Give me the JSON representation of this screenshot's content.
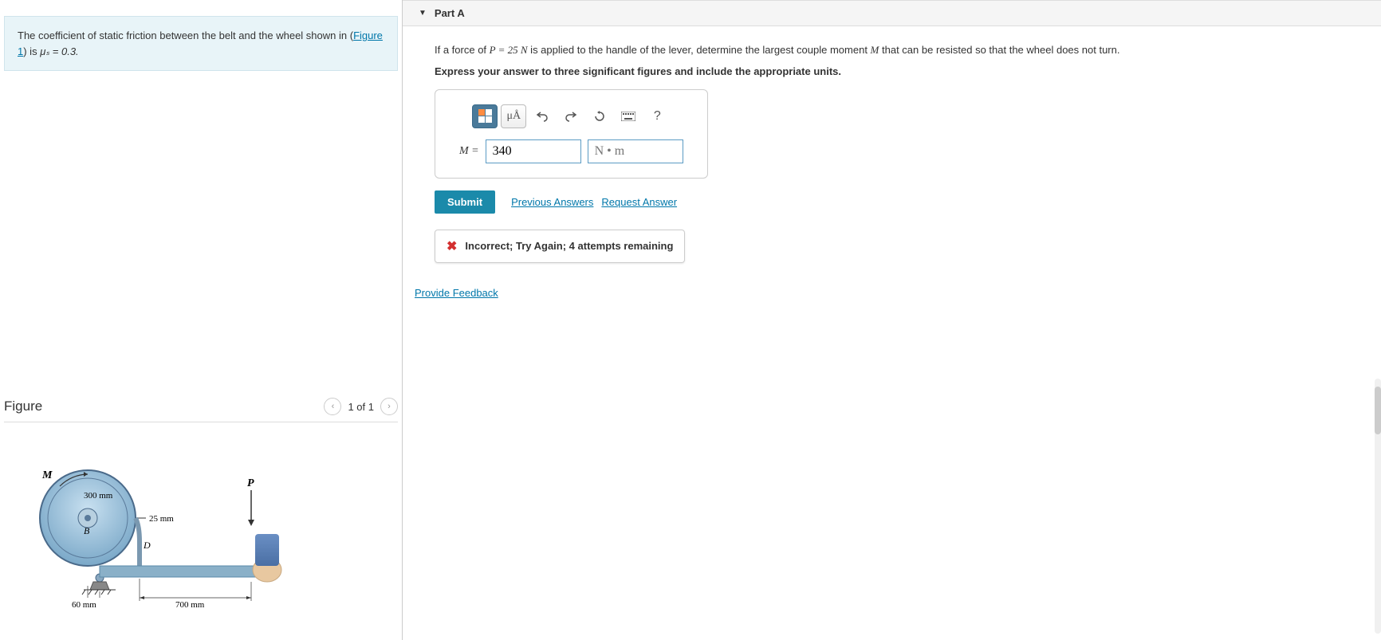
{
  "problem": {
    "text_before_link": "The coefficient of static friction between the belt and the wheel shown in (",
    "link_text": "Figure 1",
    "text_after_link": ") is ",
    "mu_s": "μₛ = 0.3."
  },
  "figure": {
    "title": "Figure",
    "nav_text": "1 of 1",
    "labels": {
      "M": "M",
      "P": "P",
      "B": "B",
      "D": "D",
      "r300": "300 mm",
      "r25": "25 mm",
      "d60": "60 mm",
      "d700": "700 mm"
    }
  },
  "partA": {
    "title": "Part A",
    "question_prefix": "If a force of ",
    "P_eq": "P = 25 N",
    "question_mid": " is applied to the handle of the lever, determine the largest couple moment ",
    "M_var": "M",
    "question_suffix": " that can be resisted so that the wheel does not turn.",
    "instruction": "Express your answer to three significant figures and include the appropriate units.",
    "toolbar": {
      "special": "μÅ",
      "keyboard": "⌨",
      "help": "?"
    },
    "answer": {
      "label_before": "M",
      "label_eq": " = ",
      "value": "340",
      "units_placeholder": "N • m"
    },
    "submit": "Submit",
    "previous_answers": "Previous Answers",
    "request_answer": "Request Answer",
    "feedback": "Incorrect; Try Again; 4 attempts remaining",
    "provide_feedback": "Provide Feedback"
  }
}
